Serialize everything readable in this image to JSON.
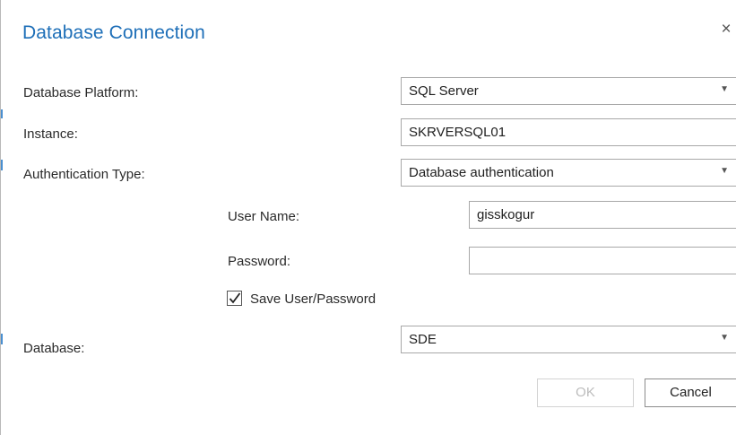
{
  "dialog": {
    "title": "Database Connection",
    "close_glyph": "×"
  },
  "form": {
    "platform": {
      "label": "Database Platform:",
      "value": "SQL Server"
    },
    "instance": {
      "label": "Instance:",
      "value": "SKRVERSQL01"
    },
    "auth_type": {
      "label": "Authentication Type:",
      "value": "Database authentication"
    },
    "user_name": {
      "label": "User Name:",
      "value": "gisskogur"
    },
    "password": {
      "label": "Password:",
      "value": ""
    },
    "save_credentials": {
      "label": "Save User/Password",
      "checked": true
    },
    "database": {
      "label": "Database:",
      "value": "SDE"
    }
  },
  "buttons": {
    "ok": "OK",
    "cancel": "Cancel"
  },
  "colors": {
    "title": "#1e6fb8",
    "field_border": "#a8a8a8",
    "disabled_text": "#bcbcbc"
  },
  "icons": {
    "dropdown": "chevron-down-icon",
    "close": "close-icon",
    "check": "checkmark-icon"
  }
}
